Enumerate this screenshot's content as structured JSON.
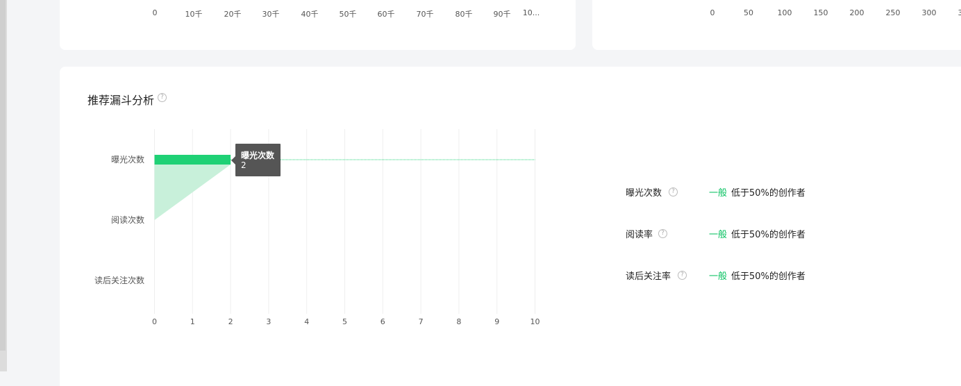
{
  "top_left_axis": {
    "ticks": [
      "0",
      "10千",
      "20千",
      "30千",
      "40千",
      "50千",
      "60千",
      "70千",
      "80千",
      "90千",
      "10..."
    ]
  },
  "top_right_axis": {
    "ticks": [
      "0",
      "50",
      "100",
      "150",
      "200",
      "250",
      "300",
      "3"
    ]
  },
  "section": {
    "title": "推荐漏斗分析",
    "help_glyph": "?"
  },
  "chart_data": {
    "type": "bar",
    "orientation": "horizontal",
    "categories": [
      "曝光次数",
      "阅读次数",
      "读后关注次数"
    ],
    "values": [
      2,
      0,
      0
    ],
    "xlim": [
      0,
      10
    ],
    "x_ticks": [
      "0",
      "1",
      "2",
      "3",
      "4",
      "5",
      "6",
      "7",
      "8",
      "9",
      "10"
    ],
    "grid": true,
    "bar_color": "#1fd175",
    "funnel_fill_color": "#c8f0da",
    "tooltip": {
      "title": "曝光次数",
      "value": "2"
    }
  },
  "metrics": [
    {
      "label": "曝光次数",
      "level": "一般",
      "desc": "低于50%的创作者"
    },
    {
      "label": "阅读率",
      "level": "一般",
      "desc": "低于50%的创作者"
    },
    {
      "label": "读后关注率",
      "level": "一般",
      "desc": "低于50%的创作者"
    }
  ],
  "colors": {
    "accent_green": "#07c160",
    "tooltip_bg": "#555555"
  }
}
